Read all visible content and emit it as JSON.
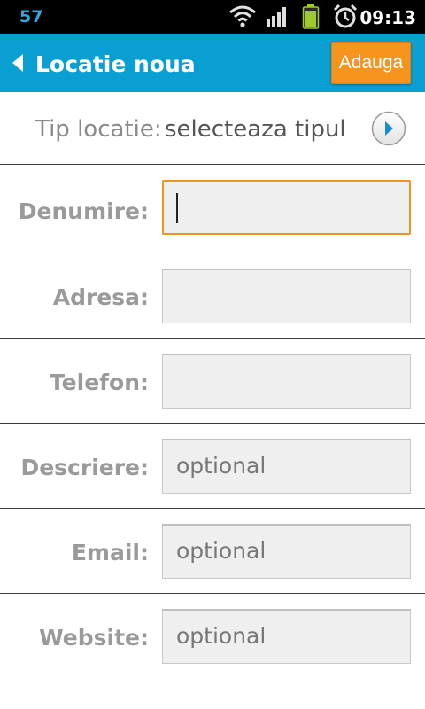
{
  "status_bar": {
    "notification_count": "57",
    "time": "09:13",
    "icons": [
      "wifi-icon",
      "signal-icon",
      "battery-icon",
      "alarm-icon"
    ]
  },
  "action_bar": {
    "title": "Locatie noua",
    "add_button": "Adauga",
    "back_icon": "back-arrow-icon",
    "accent_color": "#0a9fd3",
    "button_color": "#f7941e"
  },
  "type_row": {
    "label": "Tip locatie:",
    "value": "selecteaza tipul",
    "icon": "chevron-right-circle-icon"
  },
  "fields": [
    {
      "label": "Denumire:",
      "value": "",
      "placeholder": ""
    },
    {
      "label": "Adresa:",
      "value": "",
      "placeholder": ""
    },
    {
      "label": "Telefon:",
      "value": "",
      "placeholder": ""
    },
    {
      "label": "Descriere:",
      "value": "",
      "placeholder": "optional"
    },
    {
      "label": "Email:",
      "value": "",
      "placeholder": "optional"
    },
    {
      "label": "Website:",
      "value": "",
      "placeholder": "optional"
    }
  ]
}
